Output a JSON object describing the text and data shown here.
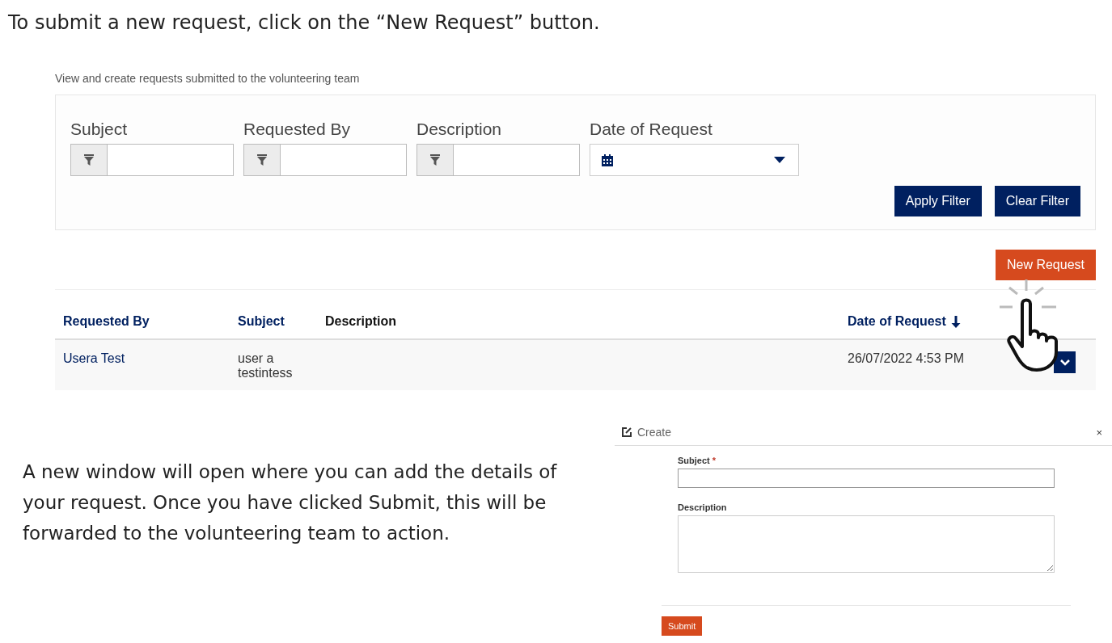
{
  "instruction": "To submit a new request, click on the “New Request” button.",
  "panel": {
    "caption": "View and create requests submitted to the volunteering team",
    "filters": [
      {
        "kind": "text",
        "label": "Subject"
      },
      {
        "kind": "text",
        "label": "Requested By"
      },
      {
        "kind": "text",
        "label": "Description"
      },
      {
        "kind": "date",
        "label": "Date of Request"
      }
    ],
    "buttons": [
      "Apply Filter",
      "Clear Filter"
    ]
  },
  "new_request_button": "New Request",
  "table": {
    "columns": [
      {
        "label": "Requested By",
        "sorted": false
      },
      {
        "label": "Subject",
        "sorted": false
      },
      {
        "label": "Description",
        "sorted": false
      },
      {
        "label": "Date of Request",
        "sorted": true
      }
    ],
    "rows": [
      {
        "requested_by": "Usera Test",
        "subject": "user a testintess",
        "date": "26/07/2022 4:53 PM"
      }
    ]
  },
  "explanation": "A new window will open where you can add the details of your request. Once you have clicked Submit, this will be forwarded to the volunteering team to action.",
  "dialog": {
    "title": "Create",
    "close": "×",
    "required_mark": "*",
    "fields": [
      {
        "kind": "text",
        "label": "Subject",
        "required": true
      },
      {
        "kind": "textarea",
        "label": "Description",
        "required": false
      }
    ],
    "submit": "Submit"
  }
}
